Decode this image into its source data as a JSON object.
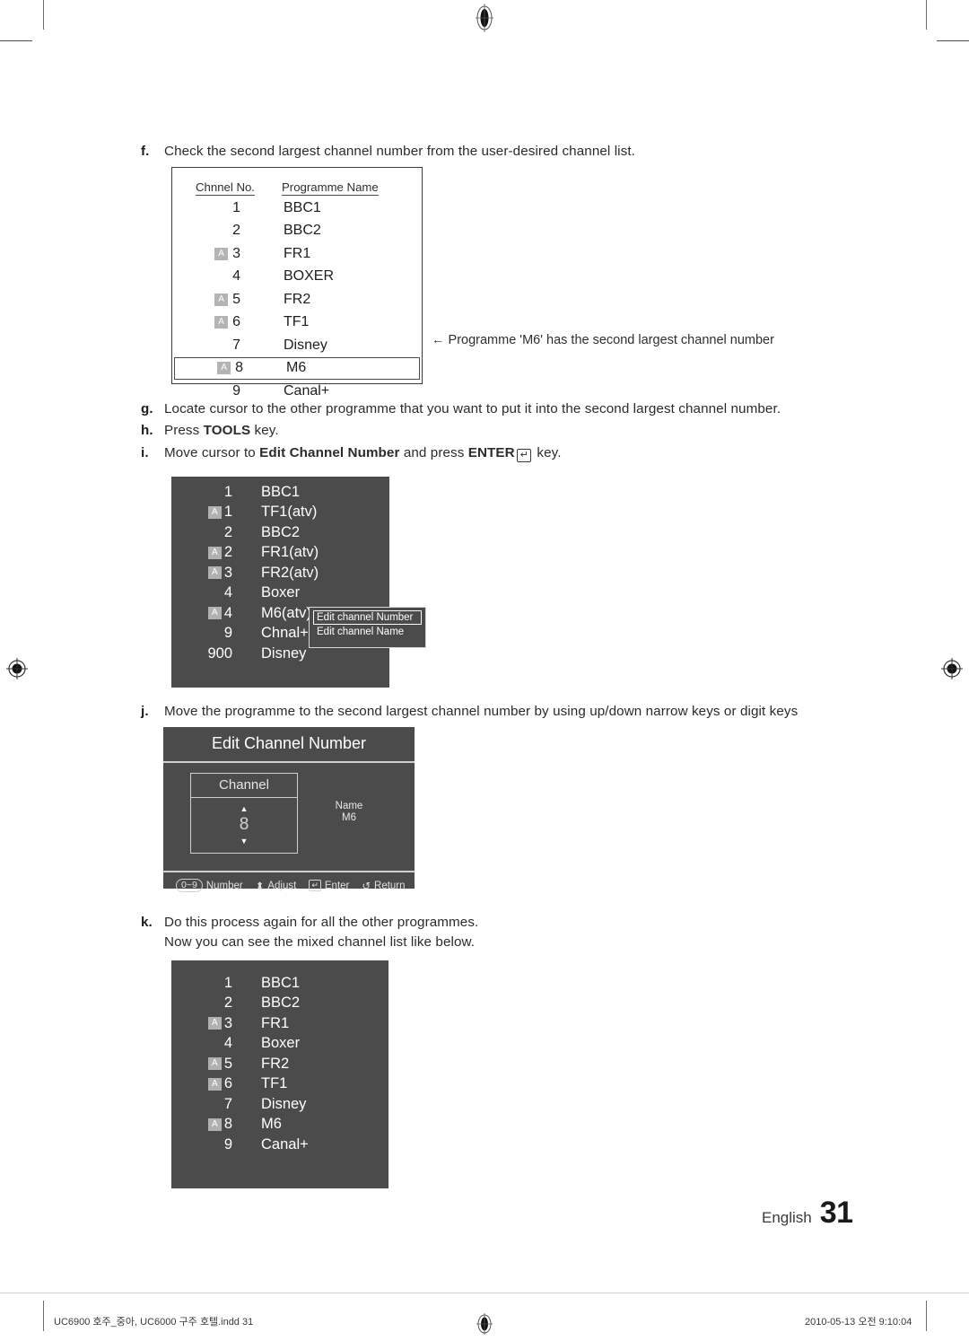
{
  "page": {
    "language_label": "English",
    "page_number": "31"
  },
  "imprint": {
    "filename": "UC6900 호주_중아, UC6000 구주 호텔.indd   31",
    "timestamp": "2010-05-13   오전 9:10:04"
  },
  "steps": {
    "f": {
      "marker": "f.",
      "text": "Check the second largest channel number from the user-desired channel list."
    },
    "g": {
      "marker": "g.",
      "text": "Locate cursor to the other programme that you want to put it into the second largest channel number."
    },
    "h": {
      "marker": "h.",
      "text_before": "Press ",
      "key": "TOOLS",
      "text_after": " key."
    },
    "i": {
      "marker": "i.",
      "text_before": "Move cursor to ",
      "bold": "Edit Channel Number",
      "text_mid": " and press ",
      "key": "ENTER",
      "key_glyph": "↵",
      "text_after": " key."
    },
    "j": {
      "marker": "j.",
      "text": "Move the programme to the second largest channel number by using up/down narrow keys or digit keys"
    },
    "k": {
      "marker": "k.",
      "text": "Do this process again for all the other programmes.\nNow you can see the mixed channel list like below."
    }
  },
  "channel_table_f": {
    "headers": {
      "number": "Chnnel No.",
      "name": "Programme Name"
    },
    "rows": [
      {
        "badge": "",
        "no": "1",
        "name": "BBC1",
        "selected": false
      },
      {
        "badge": "",
        "no": "2",
        "name": "BBC2",
        "selected": false
      },
      {
        "badge": "A",
        "no": "3",
        "name": "FR1",
        "selected": false
      },
      {
        "badge": "",
        "no": "4",
        "name": "BOXER",
        "selected": false
      },
      {
        "badge": "A",
        "no": "5",
        "name": "FR2",
        "selected": false
      },
      {
        "badge": "A",
        "no": "6",
        "name": "TF1",
        "selected": false
      },
      {
        "badge": "",
        "no": "7",
        "name": "Disney",
        "selected": false
      },
      {
        "badge": "A",
        "no": "8",
        "name": "M6",
        "selected": true
      },
      {
        "badge": "",
        "no": "9",
        "name": "Canal+",
        "selected": false
      }
    ],
    "annotation": "←  Programme 'M6' has the second largest channel number"
  },
  "osd_list_i": {
    "rows": [
      {
        "badge": "",
        "no": "1",
        "name": "BBC1"
      },
      {
        "badge": "A",
        "no": "1",
        "name": "TF1(atv)"
      },
      {
        "badge": "",
        "no": "2",
        "name": "BBC2"
      },
      {
        "badge": "A",
        "no": "2",
        "name": "FR1(atv)"
      },
      {
        "badge": "A",
        "no": "3",
        "name": "FR2(atv)"
      },
      {
        "badge": "",
        "no": "4",
        "name": "Boxer"
      },
      {
        "badge": "A",
        "no": "4",
        "name": "M6(atv)"
      },
      {
        "badge": "",
        "no": "9",
        "name": "Chnal+"
      },
      {
        "badge": "",
        "no": "900",
        "name": "Disney"
      }
    ],
    "popup": {
      "items": [
        {
          "label": "Edit channel Number",
          "active": true
        },
        {
          "label": "Edit channel Name",
          "active": false
        }
      ]
    }
  },
  "edit_dialog_j": {
    "title": "Edit Channel Number",
    "channel_label": "Channel",
    "channel_value": "8",
    "up_arrow": "▲",
    "down_arrow": "▼",
    "name_label": "Name",
    "name_value": "M6",
    "footer": {
      "number_pill": "0~9",
      "number_label": "Number",
      "adjust_glyph": "⬍",
      "adjust_label": "Adjust",
      "enter_glyph": "↵",
      "enter_label": "Enter",
      "return_glyph": "↺",
      "return_label": "Return"
    }
  },
  "osd_list_k": {
    "rows": [
      {
        "badge": "",
        "no": "1",
        "name": "BBC1"
      },
      {
        "badge": "",
        "no": "2",
        "name": "BBC2"
      },
      {
        "badge": "A",
        "no": "3",
        "name": "FR1"
      },
      {
        "badge": "",
        "no": "4",
        "name": "Boxer"
      },
      {
        "badge": "A",
        "no": "5",
        "name": "FR2"
      },
      {
        "badge": "A",
        "no": "6",
        "name": "TF1"
      },
      {
        "badge": "",
        "no": "7",
        "name": "Disney"
      },
      {
        "badge": "A",
        "no": "8",
        "name": "M6"
      },
      {
        "badge": "",
        "no": "9",
        "name": "Canal+"
      }
    ]
  }
}
